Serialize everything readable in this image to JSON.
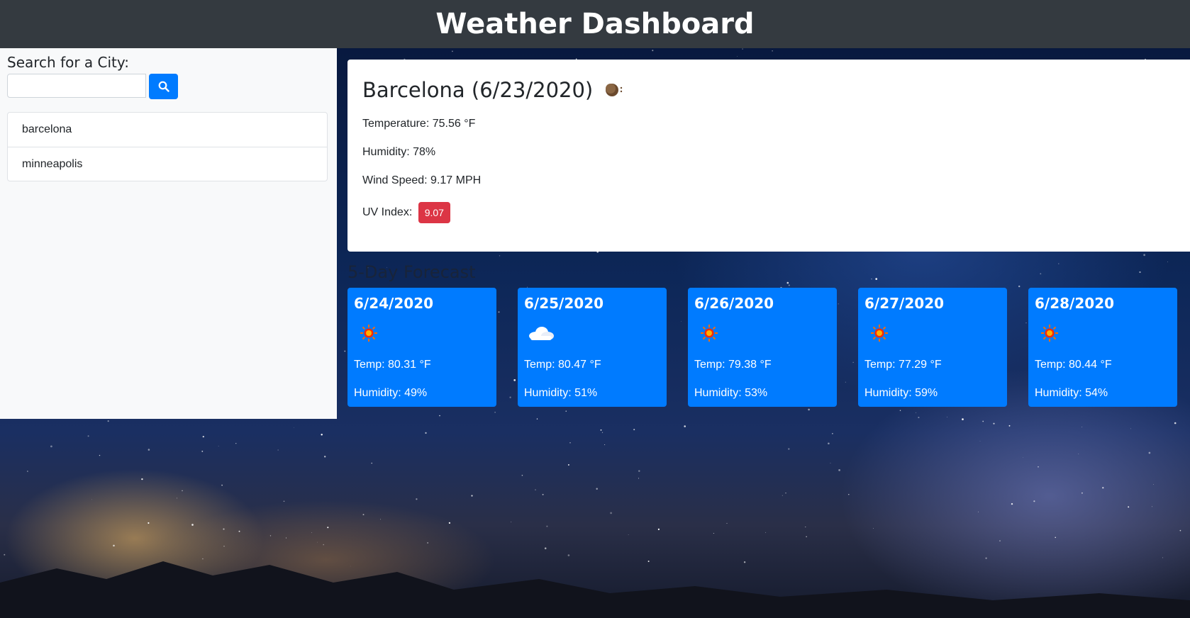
{
  "header": {
    "title": "Weather Dashboard"
  },
  "sidebar": {
    "search_label": "Search for a City:",
    "search_value": "",
    "history": [
      "barcelona",
      "minneapolis"
    ]
  },
  "current": {
    "title": "Barcelona (6/23/2020)",
    "temperature": "Temperature: 75.56 °F",
    "humidity": "Humidity: 78%",
    "wind": "Wind Speed: 9.17 MPH",
    "uv_label": "UV Index:",
    "uv_value": "9.07",
    "icon": "night-moon-icon"
  },
  "forecast": {
    "title": "5-Day Forecast",
    "days": [
      {
        "date": "6/24/2020",
        "icon": "sun-icon",
        "temp": "Temp: 80.31 °F",
        "humidity": "Humidity: 49%"
      },
      {
        "date": "6/25/2020",
        "icon": "cloud-icon",
        "temp": "Temp: 80.47 °F",
        "humidity": "Humidity: 51%"
      },
      {
        "date": "6/26/2020",
        "icon": "sun-icon",
        "temp": "Temp: 79.38 °F",
        "humidity": "Humidity: 53%"
      },
      {
        "date": "6/27/2020",
        "icon": "sun-icon",
        "temp": "Temp: 77.29 °F",
        "humidity": "Humidity: 59%"
      },
      {
        "date": "6/28/2020",
        "icon": "sun-icon",
        "temp": "Temp: 80.44 °F",
        "humidity": "Humidity: 54%"
      }
    ]
  },
  "colors": {
    "header_bg": "#343a40",
    "primary": "#007bff",
    "danger": "#dc3545"
  }
}
